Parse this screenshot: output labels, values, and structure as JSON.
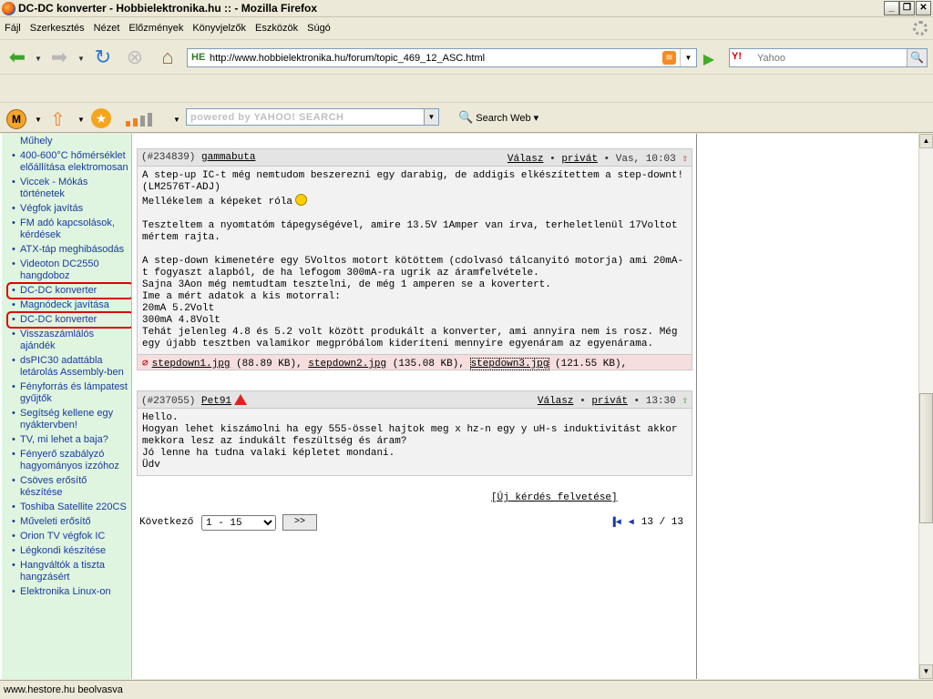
{
  "window": {
    "title": "DC-DC konverter - Hobbielektronika.hu :: - Mozilla Firefox"
  },
  "menu": [
    "Fájl",
    "Szerkesztés",
    "Nézet",
    "Előzmények",
    "Könyvjelzők",
    "Eszközök",
    "Súgó"
  ],
  "nav": {
    "url": "http://www.hobbielektronika.hu/forum/topic_469_12_ASC.html",
    "url_badge": "HE",
    "search_placeholder": "Yahoo",
    "search_engine": "Y!"
  },
  "yahoo_toolbar": {
    "search_placeholder": "powered by YAHOO! SEARCH",
    "search_web_label": "Search Web"
  },
  "sidebar": {
    "items": [
      {
        "label": "Műhely",
        "highlighted": false
      },
      {
        "label": "400-600°C hőmérséklet előállítása elektromosan",
        "highlighted": false
      },
      {
        "label": "Viccek - Mókás történetek",
        "highlighted": false
      },
      {
        "label": "Végfok javítás",
        "highlighted": false
      },
      {
        "label": "FM adó kapcsolások, kérdések",
        "highlighted": false
      },
      {
        "label": "ATX-táp meghibásodás",
        "highlighted": false
      },
      {
        "label": "Videoton DC2550 hangdoboz",
        "highlighted": false
      },
      {
        "label": "DC-DC konverter",
        "highlighted": true
      },
      {
        "label": "Magnódeck javítása",
        "highlighted": false
      },
      {
        "label": "DC-DC konverter",
        "highlighted": true
      },
      {
        "label": "Visszaszámlálós ajándék",
        "highlighted": false
      },
      {
        "label": "dsPIC30 adattábla letárolás Assembly-ben",
        "highlighted": false
      },
      {
        "label": "Fényforrás és lámpatest gyűjtők",
        "highlighted": false
      },
      {
        "label": "Segítség kellene egy nyáktervben!",
        "highlighted": false
      },
      {
        "label": "TV, mi lehet a baja?",
        "highlighted": false
      },
      {
        "label": "Fényerő szabályzó hagyományos izzóhoz",
        "highlighted": false
      },
      {
        "label": "Csöves erősítő készítése",
        "highlighted": false
      },
      {
        "label": "Toshiba Satellite 220CS",
        "highlighted": false
      },
      {
        "label": "Műveleti erősítő",
        "highlighted": false
      },
      {
        "label": "Orion TV végfok IC",
        "highlighted": false
      },
      {
        "label": "Légkondi készítése",
        "highlighted": false
      },
      {
        "label": "Hangváltók a tiszta hangzásért",
        "highlighted": false
      },
      {
        "label": "Elektronika Linux-on",
        "highlighted": false
      }
    ]
  },
  "posts": [
    {
      "id": "(#234839)",
      "user": "gammabuta",
      "reply_label": "Válasz",
      "private_label": "privát",
      "sep": "•",
      "time": "Vas, 10:03",
      "body_lines": [
        "A step-up IC-t még nemtudom beszerezni egy darabig, de addigis elkészítettem a step-downt!",
        "(LM2576T-ADJ)",
        "Mellékelem a képeket róla",
        "",
        "Teszteltem a nyomtatóm tápegységével, amire 13.5V 1Amper van írva, terheletlenül 17Voltot mértem rajta.",
        "",
        "A step-down kimenetére egy 5Voltos motort kötöttem (cdolvasó tálcanyitó motorja) ami 20mA-t fogyaszt alapból, de ha lefogom 300mA-ra ugrik az áramfelvétele.",
        "Sajna 3Aon még nemtudtam tesztelni, de még 1 amperen se a kovertert.",
        "Ime a mért adatok a kis motorral:",
        "20mA 5.2Volt",
        "300mA 4.8Volt",
        "Tehát jelenleg 4.8 és 5.2 volt között produkált a konverter, ami annyira nem is rosz. Még egy újabb tesztben valamikor megpróbálom kideríteni mennyire egyenáram az egyenárama."
      ],
      "attachments": [
        {
          "name": "stepdown1.jpg",
          "size": "(88.89 KB),"
        },
        {
          "name": "stepdown2.jpg",
          "size": "(135.08 KB),"
        },
        {
          "name": "stepdown3.jpg",
          "size": "(121.55 KB),"
        }
      ]
    },
    {
      "id": "(#237055)",
      "user": "Pet91",
      "reply_label": "Válasz",
      "private_label": "privát",
      "sep": "•",
      "time": "13:30",
      "body_lines": [
        "Hello.",
        "Hogyan lehet kiszámolni ha egy 555-össel hajtok meg x hz-n egy y uH-s induktivitást akkor mekkora lesz az indukált feszültség és áram?",
        "Jó lenne ha tudna valaki képletet mondani.",
        "Üdv"
      ]
    }
  ],
  "new_question": "[Új kérdés felvetése]",
  "pager": {
    "next_label": "Következő",
    "range_selected": "1 - 15",
    "go_label": ">>",
    "page_info": "13 / 13"
  },
  "status": "www.hestore.hu beolvasva"
}
